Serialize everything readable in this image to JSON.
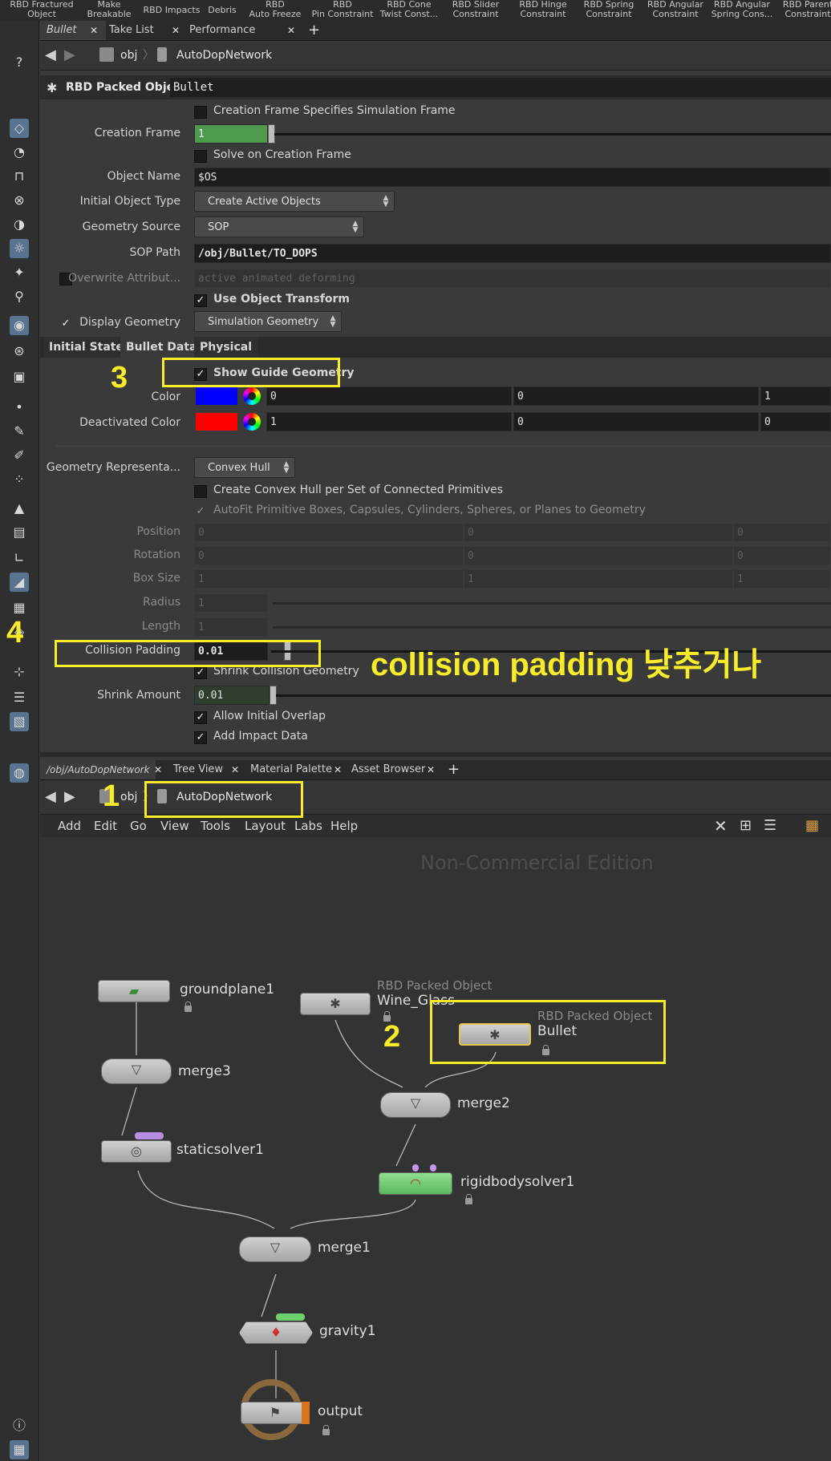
{
  "shelf": {
    "tools": [
      {
        "label": "RBD Fractured\nObject"
      },
      {
        "label": "Make\nBreakable"
      },
      {
        "label": "RBD Impacts"
      },
      {
        "label": "Debris"
      },
      {
        "label": "RBD\nAuto Freeze"
      },
      {
        "label": "RBD\nPin Constraint"
      },
      {
        "label": "RBD Cone\nTwist Const..."
      },
      {
        "label": "RBD Slider\nConstraint"
      },
      {
        "label": "RBD Hinge\nConstraint"
      },
      {
        "label": "RBD Spring\nConstraint"
      },
      {
        "label": "RBD Angular\nConstraint"
      },
      {
        "label": "RBD Angular\nSpring Cons..."
      },
      {
        "label": "RBD Parent\nConstraint"
      }
    ]
  },
  "top_pane": {
    "tabs": [
      "Bullet",
      "Take List",
      "Performance Monitor"
    ],
    "path": {
      "root": "obj",
      "node": "AutoDopNetwork"
    }
  },
  "params": {
    "node_type": "RBD Packed Object",
    "node_name": "Bullet",
    "creation_frame_specifies": "Creation Frame Specifies Simulation Frame",
    "creation_frame": {
      "label": "Creation Frame",
      "value": "1"
    },
    "solve_on_creation": "Solve on Creation Frame",
    "object_name": {
      "label": "Object Name",
      "value": "$OS"
    },
    "initial_object_type": {
      "label": "Initial Object Type",
      "value": "Create Active Objects"
    },
    "geometry_source": {
      "label": "Geometry Source",
      "value": "SOP"
    },
    "sop_path": {
      "label": "SOP Path",
      "value": "/obj/Bullet/TO_DOPS"
    },
    "overwrite": {
      "label": "Overwrite Attribut...",
      "value": "active animated deforming"
    },
    "use_object_transform": "Use Object Transform",
    "display_geometry": {
      "label": "Display Geometry",
      "value": "Simulation Geometry"
    },
    "tabs": [
      "Initial State",
      "Bullet Data",
      "Physical"
    ],
    "show_guide": "Show Guide Geometry",
    "color": {
      "label": "Color",
      "hex": "#0000ff",
      "values": [
        "0",
        "0",
        "1"
      ]
    },
    "deactivated_color": {
      "label": "Deactivated Color",
      "hex": "#ff0000",
      "values": [
        "1",
        "0",
        "0"
      ]
    },
    "geometry_representation": {
      "label": "Geometry Representa...",
      "value": "Convex Hull"
    },
    "convex_hull_per_set": "Create Convex Hull per Set of Connected Primitives",
    "autofit": "AutoFit Primitive Boxes, Capsules, Cylinders, Spheres, or Planes to Geometry",
    "position": {
      "label": "Position",
      "values": [
        "0",
        "0",
        "0"
      ]
    },
    "rotation": {
      "label": "Rotation",
      "values": [
        "0",
        "0",
        "0"
      ]
    },
    "box_size": {
      "label": "Box Size",
      "values": [
        "1",
        "1",
        "1"
      ]
    },
    "radius": {
      "label": "Radius",
      "value": "1"
    },
    "length": {
      "label": "Length",
      "value": "1"
    },
    "collision_padding": {
      "label": "Collision Padding",
      "value": "0.01"
    },
    "shrink_collision": "Shrink Collision Geometry",
    "shrink_amount": {
      "label": "Shrink Amount",
      "value": "0.01"
    },
    "allow_initial_overlap": "Allow Initial Overlap",
    "add_impact_data": "Add Impact Data"
  },
  "bottom_pane": {
    "tabs": [
      "/obj/AutoDopNetwork",
      "Tree View",
      "Material Palette",
      "Asset Browser"
    ],
    "path": {
      "root": "obj",
      "node": "AutoDopNetwork"
    },
    "menu": [
      "Add",
      "Edit",
      "Go",
      "View",
      "Tools",
      "Layout",
      "Labs",
      "Help"
    ],
    "watermark": "Non-Commercial Edition"
  },
  "nodes": {
    "groundplane1": "groundplane1",
    "merge3": "merge3",
    "staticsolver1": "staticsolver1",
    "wine_glass_type": "RBD Packed Object",
    "wine_glass": "Wine_Glass",
    "bullet_type": "RBD Packed Object",
    "bullet": "Bullet",
    "merge2": "merge2",
    "rigidbodysolver1": "rigidbodysolver1",
    "merge1": "merge1",
    "gravity1": "gravity1",
    "output": "output"
  },
  "annotations": {
    "n1": "1",
    "n2": "2",
    "n3": "3",
    "n4": "4",
    "note": "collision padding 낮추거나",
    "color": "#f6ec2a"
  }
}
